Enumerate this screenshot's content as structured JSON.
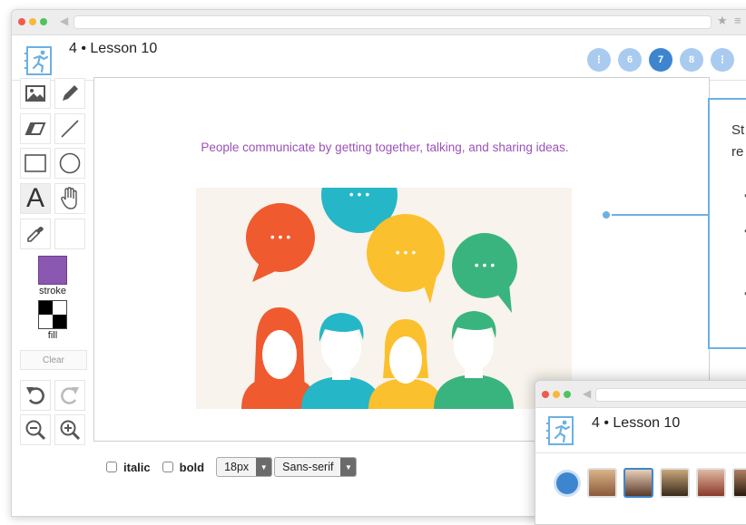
{
  "app": {
    "lesson_title": "4 • Lesson 10",
    "logo_icon": "running-figure-notebook-icon"
  },
  "pager": {
    "items": [
      "⁝",
      "6",
      "7",
      "8",
      "⁝"
    ],
    "active": "7"
  },
  "tools": {
    "stroke_label": "stroke",
    "fill_label": "fill",
    "clear_label": "Clear",
    "stroke_color": "#8a57b1",
    "text_tool_glyph": "A"
  },
  "canvas": {
    "caption": "People communicate by getting together, talking, and sharing ideas.",
    "bubble_dots": "• • •"
  },
  "text_options": {
    "italic_label": "italic",
    "bold_label": "bold",
    "size_value": "18px",
    "font_value": "Sans-serif"
  },
  "callout": {
    "line1": "St",
    "line2": "re",
    "bullet": "•"
  },
  "student_window": {
    "lesson_title": "4 • Lesson 10"
  },
  "colors": {
    "accent": "#3d86cf",
    "callout_border": "#6bb1e3",
    "caption_text": "#9a52b8"
  }
}
